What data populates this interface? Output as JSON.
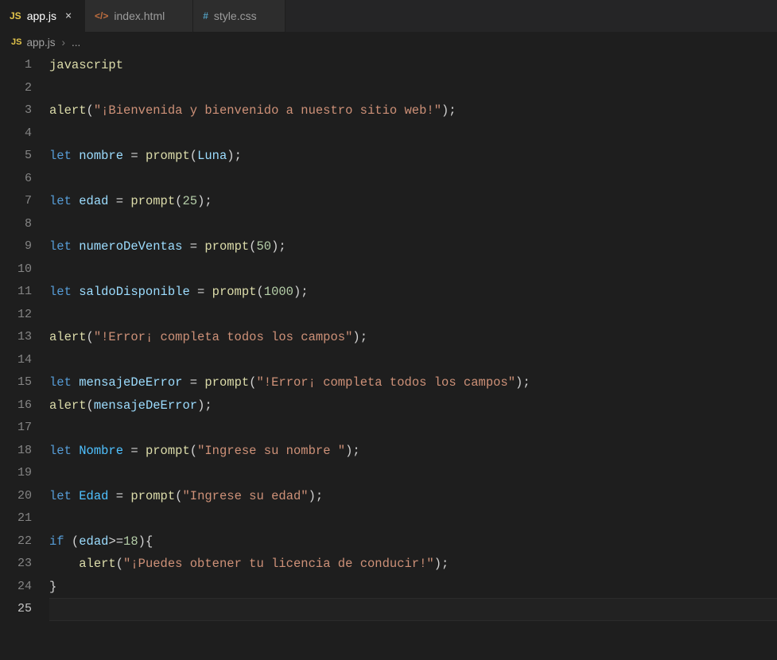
{
  "tabs": [
    {
      "icon": "JS",
      "icon_class": "js-icon",
      "label": "app.js",
      "active": true,
      "close": "×"
    },
    {
      "icon": "</>",
      "icon_class": "html-icon",
      "label": "index.html",
      "active": false
    },
    {
      "icon": "#",
      "icon_class": "css-icon",
      "label": "style.css",
      "active": false
    }
  ],
  "breadcrumb": {
    "icon": "JS",
    "file": "app.js",
    "sep": "›",
    "more": "..."
  },
  "code": {
    "lines": [
      [
        {
          "c": "mtk-fn",
          "t": "javascript"
        }
      ],
      [],
      [
        {
          "c": "mtk-fn",
          "t": "alert"
        },
        {
          "c": "mtk-plain",
          "t": "("
        },
        {
          "c": "mtk-str",
          "t": "\"¡Bienvenida y bienvenido a nuestro sitio web!\""
        },
        {
          "c": "mtk-plain",
          "t": ");"
        }
      ],
      [],
      [
        {
          "c": "mtk-kw",
          "t": "let"
        },
        {
          "c": "mtk-plain",
          "t": " "
        },
        {
          "c": "mtk-var",
          "t": "nombre"
        },
        {
          "c": "mtk-plain",
          "t": " = "
        },
        {
          "c": "mtk-fn",
          "t": "prompt"
        },
        {
          "c": "mtk-plain",
          "t": "("
        },
        {
          "c": "mtk-var",
          "t": "Luna"
        },
        {
          "c": "mtk-plain",
          "t": ");"
        }
      ],
      [],
      [
        {
          "c": "mtk-kw",
          "t": "let"
        },
        {
          "c": "mtk-plain",
          "t": " "
        },
        {
          "c": "mtk-var",
          "t": "edad"
        },
        {
          "c": "mtk-plain",
          "t": " = "
        },
        {
          "c": "mtk-fn",
          "t": "prompt"
        },
        {
          "c": "mtk-plain",
          "t": "("
        },
        {
          "c": "mtk-num",
          "t": "25"
        },
        {
          "c": "mtk-plain",
          "t": ");"
        }
      ],
      [],
      [
        {
          "c": "mtk-kw",
          "t": "let"
        },
        {
          "c": "mtk-plain",
          "t": " "
        },
        {
          "c": "mtk-var",
          "t": "numeroDeVentas"
        },
        {
          "c": "mtk-plain",
          "t": " = "
        },
        {
          "c": "mtk-fn",
          "t": "prompt"
        },
        {
          "c": "mtk-plain",
          "t": "("
        },
        {
          "c": "mtk-num",
          "t": "50"
        },
        {
          "c": "mtk-plain",
          "t": ");"
        }
      ],
      [],
      [
        {
          "c": "mtk-kw",
          "t": "let"
        },
        {
          "c": "mtk-plain",
          "t": " "
        },
        {
          "c": "mtk-var",
          "t": "saldoDisponible"
        },
        {
          "c": "mtk-plain",
          "t": " = "
        },
        {
          "c": "mtk-fn",
          "t": "prompt"
        },
        {
          "c": "mtk-plain",
          "t": "("
        },
        {
          "c": "mtk-num",
          "t": "1000"
        },
        {
          "c": "mtk-plain",
          "t": ");"
        }
      ],
      [],
      [
        {
          "c": "mtk-fn",
          "t": "alert"
        },
        {
          "c": "mtk-plain",
          "t": "("
        },
        {
          "c": "mtk-str",
          "t": "\"!Error¡ completa todos los campos\""
        },
        {
          "c": "mtk-plain",
          "t": ");"
        }
      ],
      [],
      [
        {
          "c": "mtk-kw",
          "t": "let"
        },
        {
          "c": "mtk-plain",
          "t": " "
        },
        {
          "c": "mtk-var",
          "t": "mensajeDeError"
        },
        {
          "c": "mtk-plain",
          "t": " = "
        },
        {
          "c": "mtk-fn",
          "t": "prompt"
        },
        {
          "c": "mtk-plain",
          "t": "("
        },
        {
          "c": "mtk-str",
          "t": "\"!Error¡ completa todos los campos\""
        },
        {
          "c": "mtk-plain",
          "t": ");"
        }
      ],
      [
        {
          "c": "mtk-fn",
          "t": "alert"
        },
        {
          "c": "mtk-plain",
          "t": "("
        },
        {
          "c": "mtk-var",
          "t": "mensajeDeError"
        },
        {
          "c": "mtk-plain",
          "t": ");"
        }
      ],
      [],
      [
        {
          "c": "mtk-kw",
          "t": "let"
        },
        {
          "c": "mtk-plain",
          "t": " "
        },
        {
          "c": "mtk-id2",
          "t": "Nombre"
        },
        {
          "c": "mtk-plain",
          "t": " = "
        },
        {
          "c": "mtk-fn",
          "t": "prompt"
        },
        {
          "c": "mtk-plain",
          "t": "("
        },
        {
          "c": "mtk-str",
          "t": "\"Ingrese su nombre \""
        },
        {
          "c": "mtk-plain",
          "t": ");"
        }
      ],
      [],
      [
        {
          "c": "mtk-kw",
          "t": "let"
        },
        {
          "c": "mtk-plain",
          "t": " "
        },
        {
          "c": "mtk-id2",
          "t": "Edad"
        },
        {
          "c": "mtk-plain",
          "t": " = "
        },
        {
          "c": "mtk-fn",
          "t": "prompt"
        },
        {
          "c": "mtk-plain",
          "t": "("
        },
        {
          "c": "mtk-str",
          "t": "\"Ingrese su edad\""
        },
        {
          "c": "mtk-plain",
          "t": ");"
        }
      ],
      [],
      [
        {
          "c": "mtk-kw",
          "t": "if"
        },
        {
          "c": "mtk-plain",
          "t": " ("
        },
        {
          "c": "mtk-var",
          "t": "edad"
        },
        {
          "c": "mtk-plain",
          "t": ">="
        },
        {
          "c": "mtk-num",
          "t": "18"
        },
        {
          "c": "mtk-plain",
          "t": "){"
        }
      ],
      [
        {
          "c": "mtk-plain",
          "t": "    "
        },
        {
          "c": "mtk-fn",
          "t": "alert"
        },
        {
          "c": "mtk-plain",
          "t": "("
        },
        {
          "c": "mtk-str",
          "t": "\"¡Puedes obtener tu licencia de conducir!\""
        },
        {
          "c": "mtk-plain",
          "t": ");"
        }
      ],
      [
        {
          "c": "mtk-plain",
          "t": "}"
        }
      ],
      []
    ],
    "current_line": 25
  }
}
